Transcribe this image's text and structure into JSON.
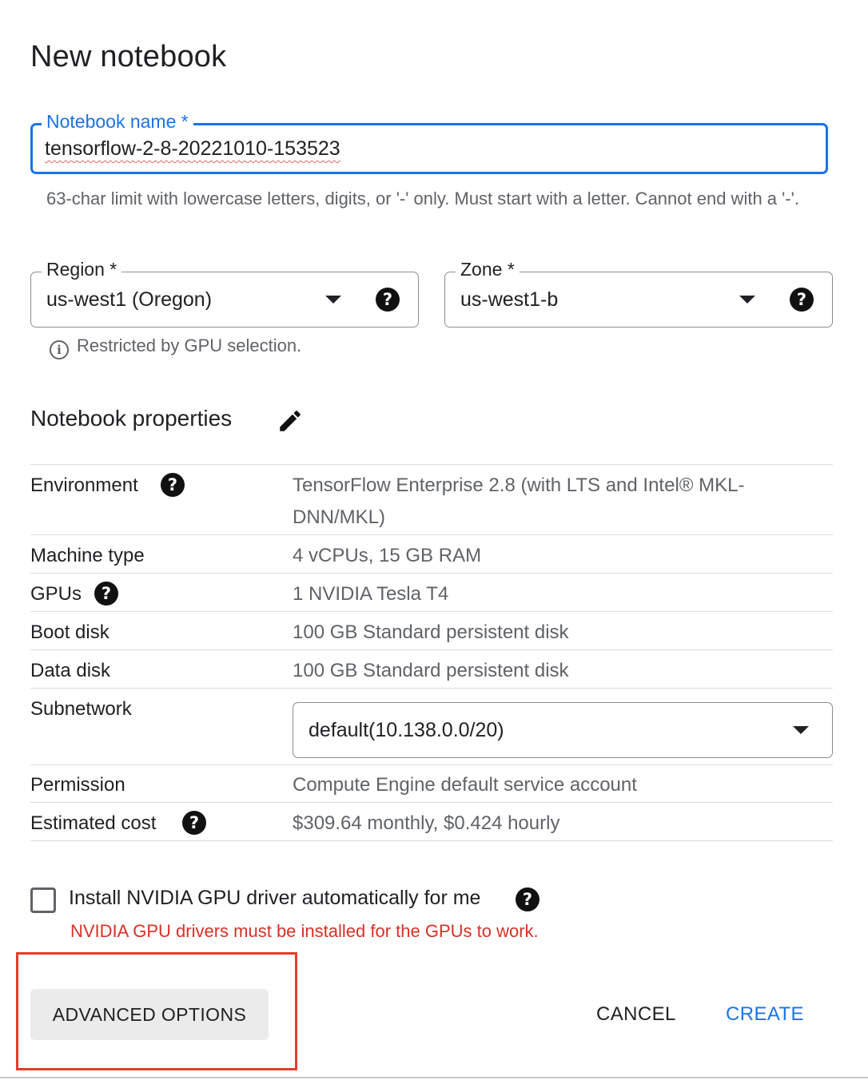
{
  "dialog": {
    "title": "New notebook"
  },
  "name_field": {
    "label": "Notebook name *",
    "value": "tensorflow-2-8-20221010-153523",
    "hint": "63-char limit with lowercase letters, digits, or '-' only. Must start with a letter. Cannot end with a '-'."
  },
  "region": {
    "label": "Region *",
    "value": "us-west1 (Oregon)"
  },
  "zone": {
    "label": "Zone *",
    "value": "us-west1-b"
  },
  "restriction_note": "Restricted by GPU selection.",
  "help_glyph": "?",
  "info_glyph": "i",
  "properties": {
    "title": "Notebook properties",
    "rows": [
      {
        "label": "Environment",
        "value": "TensorFlow Enterprise 2.8 (with LTS and Intel® MKL-DNN/MKL)"
      },
      {
        "label": "Machine type",
        "value": "4 vCPUs, 15 GB RAM"
      },
      {
        "label": "GPUs",
        "value": "1 NVIDIA Tesla T4"
      },
      {
        "label": "Boot disk",
        "value": "100 GB Standard persistent disk"
      },
      {
        "label": "Data disk",
        "value": "100 GB Standard persistent disk"
      },
      {
        "label": "Subnetwork",
        "value": "default(10.138.0.0/20)"
      },
      {
        "label": "Permission",
        "value": "Compute Engine default service account"
      },
      {
        "label": "Estimated cost",
        "value": "$309.64 monthly, $0.424 hourly"
      }
    ]
  },
  "gpu_driver": {
    "label": "Install NVIDIA GPU driver automatically for me",
    "checked": false,
    "error": "NVIDIA GPU drivers must be installed for the GPUs to work."
  },
  "buttons": {
    "advanced": "ADVANCED OPTIONS",
    "cancel": "CANCEL",
    "create": "CREATE"
  },
  "colors": {
    "accent": "#1a73e8",
    "error": "#d93025",
    "highlight_box": "#e53c2b"
  }
}
